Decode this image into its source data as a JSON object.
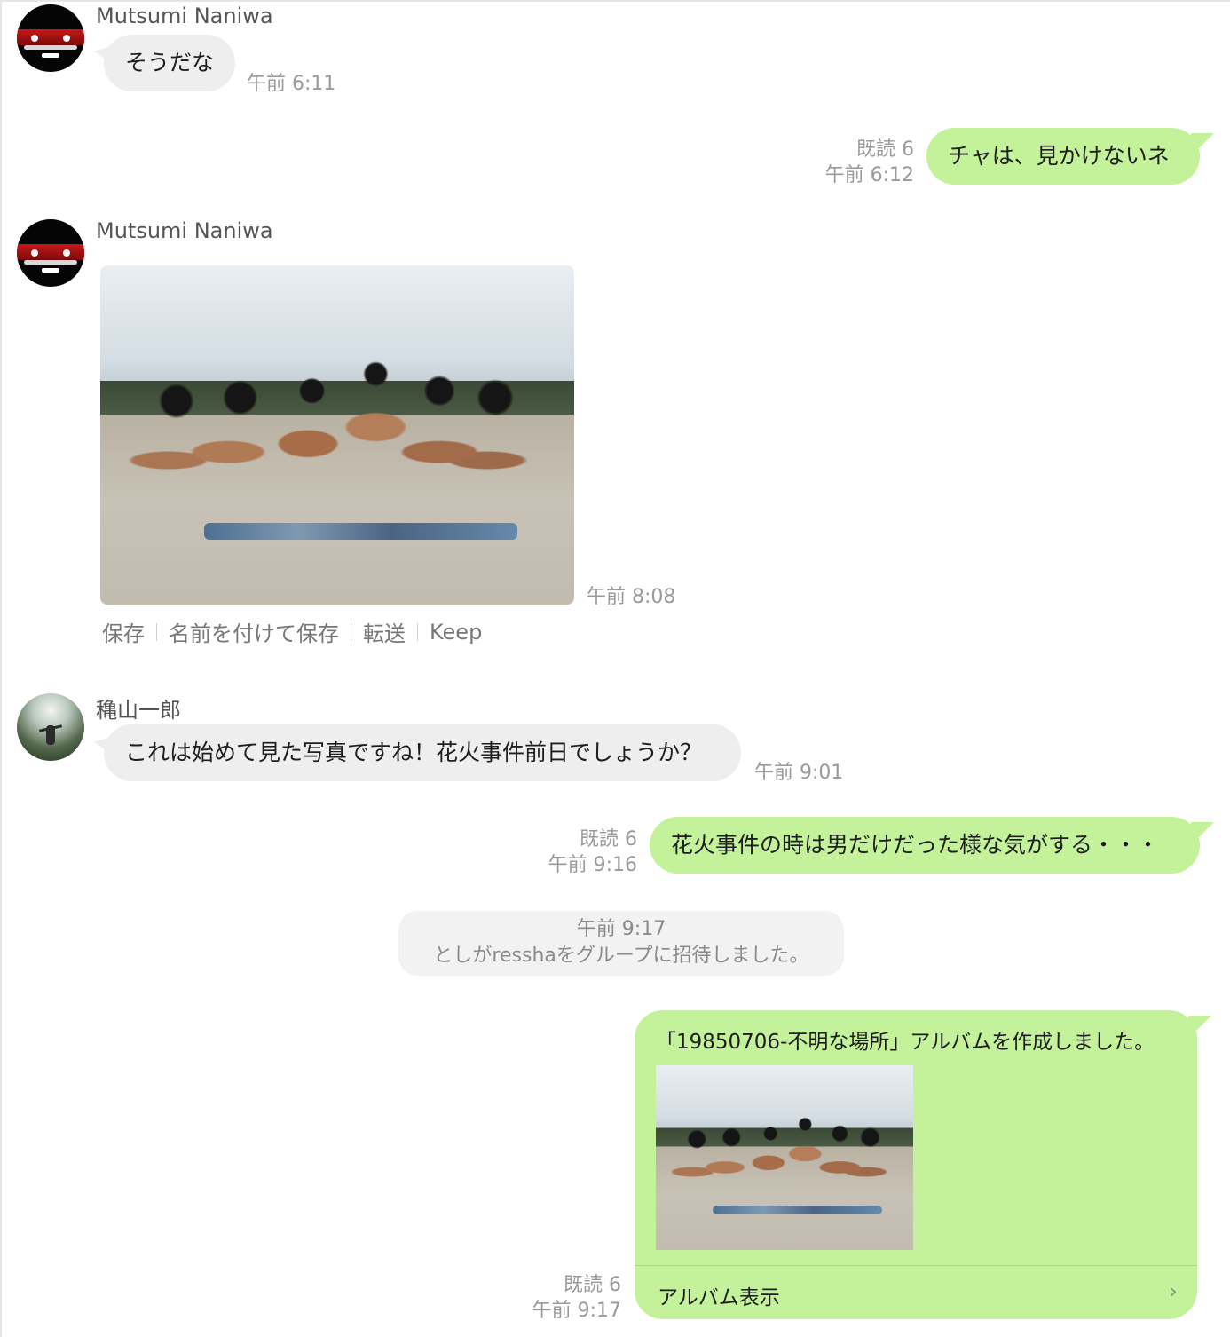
{
  "messages": [
    {
      "sender": "Mutsumi Naniwa",
      "text": "そうだな",
      "time": "午前 6:11"
    },
    {
      "text": "チャは、見かけないネ",
      "read": "既読 6",
      "time": "午前 6:12"
    },
    {
      "sender": "Mutsumi Naniwa",
      "time": "午前 8:08",
      "actions": [
        "保存",
        "名前を付けて保存",
        "転送",
        "Keep"
      ]
    },
    {
      "sender": "穐山一郎",
      "text": "これは始めて見た写真ですね！花火事件前日でしょうか？",
      "time": "午前 9:01"
    },
    {
      "text": "花火事件の時は男だけだった様な気がする・・・",
      "read": "既読 6",
      "time": "午前 9:16"
    },
    {
      "system_time": "午前 9:17",
      "system_text": "としがresshaをグループに招待しました。"
    },
    {
      "album_title": "「19850706-不明な場所」アルバムを作成しました。",
      "album_link": "アルバム表示",
      "read": "既読 6",
      "time": "午前 9:17"
    }
  ],
  "colors": {
    "outgoing": "#c4f29b",
    "incoming": "#eeeeee",
    "meta": "#9a9a9a"
  },
  "icons": {
    "album_link": "chevron-right-icon"
  }
}
